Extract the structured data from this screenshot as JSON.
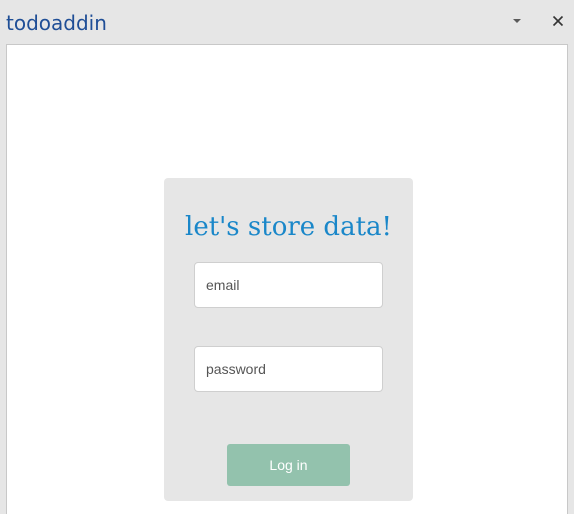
{
  "pane": {
    "title": "todoaddin",
    "dropdown_icon": "caret-down-icon",
    "close_icon": "close-icon"
  },
  "login": {
    "heading": "let's store data!",
    "email_placeholder": "email",
    "email_value": "",
    "password_placeholder": "password",
    "password_value": "",
    "submit_label": "Log in"
  },
  "colors": {
    "title_text": "#1f4e96",
    "heading_text": "#1a87c9",
    "button_bg": "#93c2ad",
    "card_bg": "#e6e6e6"
  }
}
